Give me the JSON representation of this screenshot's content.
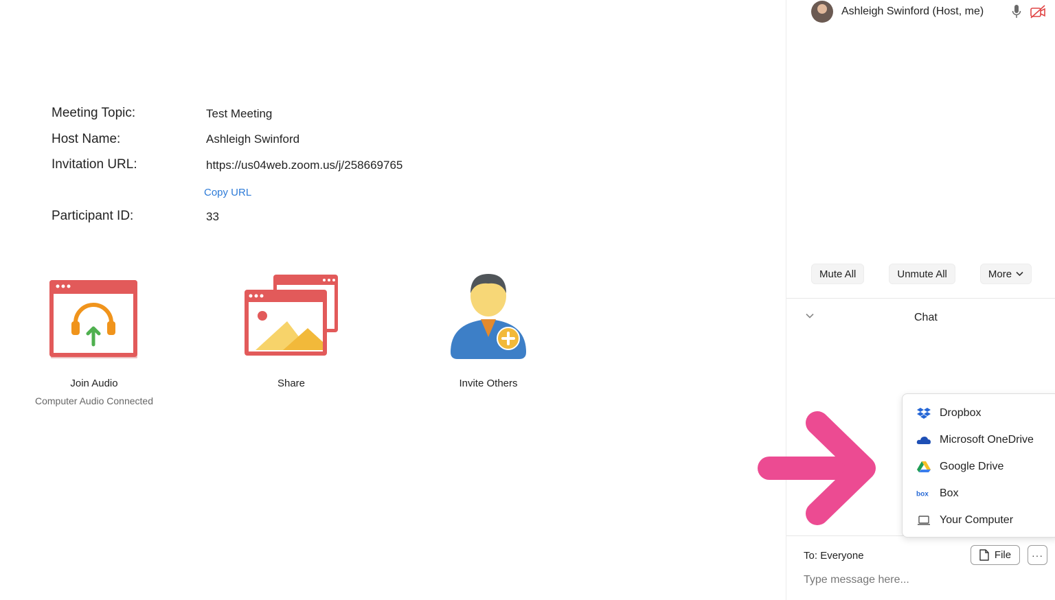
{
  "meeting_info": {
    "topic_label": "Meeting Topic:",
    "topic_value": "Test Meeting",
    "host_label": "Host Name:",
    "host_value": "Ashleigh Swinford",
    "url_label": "Invitation URL:",
    "url_value": "https://us04web.zoom.us/j/258669765",
    "copy_url": "Copy URL",
    "participant_label": "Participant ID:",
    "participant_value": "33"
  },
  "actions": [
    {
      "label": "Join Audio",
      "sub": "Computer Audio Connected",
      "icon": "headphones-window-icon"
    },
    {
      "label": "Share",
      "sub": "",
      "icon": "share-screen-icon"
    },
    {
      "label": "Invite Others",
      "sub": "",
      "icon": "invite-person-icon"
    }
  ],
  "participants": {
    "self_name": "Ashleigh Swinford (Host, me)",
    "mic_icon": "microphone-icon",
    "video_icon": "video-off-icon"
  },
  "participant_buttons": {
    "mute_all": "Mute All",
    "unmute_all": "Unmute All",
    "more": "More"
  },
  "chat": {
    "title": "Chat",
    "to_label": "To:",
    "to_value": "Everyone",
    "file_button": "File",
    "more_button": "···",
    "input_placeholder": "Type message here..."
  },
  "file_menu": {
    "items": [
      {
        "label": "Dropbox",
        "icon": "dropbox-icon"
      },
      {
        "label": "Microsoft OneDrive",
        "icon": "onedrive-icon"
      },
      {
        "label": "Google Drive",
        "icon": "google-drive-icon"
      },
      {
        "label": "Box",
        "icon": "box-icon"
      },
      {
        "label": "Your Computer",
        "icon": "laptop-icon"
      }
    ]
  },
  "colors": {
    "accent_link": "#2d7bd8",
    "icon_red": "#e25a5a",
    "annotation_arrow": "#ec4b92"
  }
}
